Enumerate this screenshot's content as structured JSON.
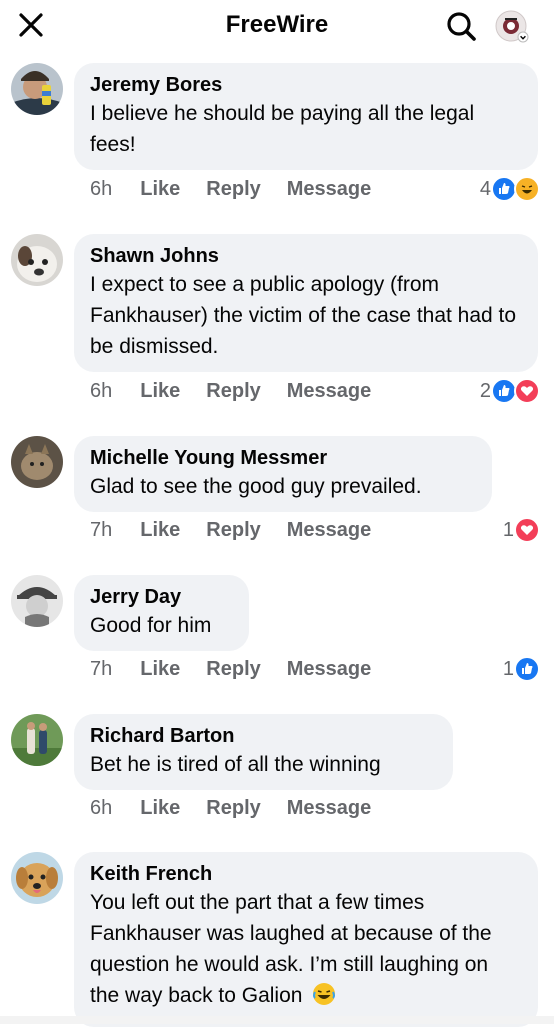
{
  "header": {
    "title": "FreeWire",
    "icons": [
      "close-icon",
      "search-icon",
      "profile-menu-icon"
    ]
  },
  "actions": {
    "like": "Like",
    "reply": "Reply",
    "message": "Message"
  },
  "colors": {
    "like_blue": "#1877f2",
    "love_red": "#f33e58",
    "haha_yellow": "#f7b125",
    "bubble_bg": "#f0f2f5",
    "meta_gray": "#65676b"
  },
  "comments": [
    {
      "author": "Jeremy Bores",
      "text": "I believe he should be paying all the legal fees!",
      "time": "6h",
      "reaction_count": "4",
      "reactions": [
        "like",
        "haha"
      ]
    },
    {
      "author": "Shawn Johns",
      "text": "I expect to see a public apology (from Fankhauser) the victim of the case that had to be dismissed.",
      "time": "6h",
      "reaction_count": "2",
      "reactions": [
        "like",
        "love"
      ]
    },
    {
      "author": "Michelle Young Messmer",
      "text": "Glad to see the good guy prevailed.",
      "time": "7h",
      "reaction_count": "1",
      "reactions": [
        "love"
      ]
    },
    {
      "author": "Jerry Day",
      "text": "Good for him",
      "time": "7h",
      "reaction_count": "1",
      "reactions": [
        "like"
      ]
    },
    {
      "author": "Richard Barton",
      "text": "Bet he is tired of all the winning",
      "time": "6h",
      "reaction_count": "",
      "reactions": []
    },
    {
      "author": "Keith French",
      "text": "You left out the part that a few times Fankhauser was laughed at because of the question he would ask. I’m still laughing on the way back to Galion",
      "time": "",
      "reaction_count": "",
      "reactions": [
        "haha"
      ]
    }
  ]
}
